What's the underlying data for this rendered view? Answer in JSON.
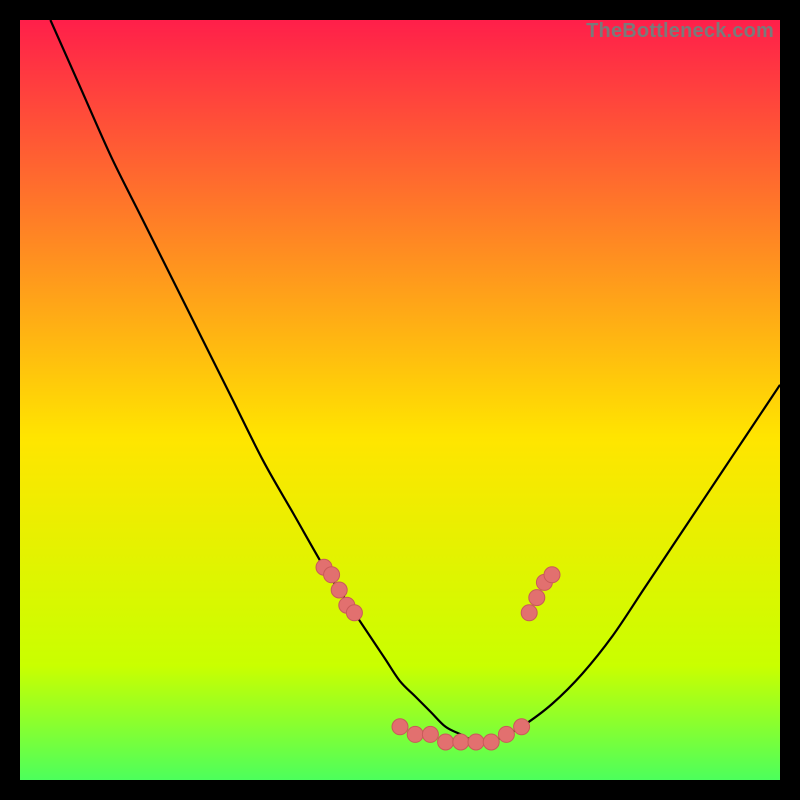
{
  "watermark": "TheBottleneck.com",
  "colors": {
    "bg_top": "#ff1f4a",
    "bg_mid": "#ffe500",
    "bg_low1": "#c9ff00",
    "bg_low2": "#4cff5c",
    "curve": "#000000",
    "dot_fill": "#e2706f",
    "dot_stroke": "#c95a59"
  },
  "chart_data": {
    "type": "line",
    "title": "",
    "xlabel": "",
    "ylabel": "",
    "xlim": [
      0,
      100
    ],
    "ylim": [
      0,
      100
    ],
    "series": [
      {
        "name": "bottleneck-curve",
        "type": "line",
        "x": [
          4,
          8,
          12,
          16,
          20,
          24,
          28,
          32,
          36,
          40,
          42,
          44,
          46,
          48,
          50,
          52,
          54,
          56,
          58,
          60,
          62,
          64,
          66,
          70,
          74,
          78,
          82,
          86,
          90,
          94,
          98,
          100
        ],
        "y": [
          100,
          91,
          82,
          74,
          66,
          58,
          50,
          42,
          35,
          28,
          25,
          22,
          19,
          16,
          13,
          11,
          9,
          7,
          6,
          5,
          5,
          6,
          7,
          10,
          14,
          19,
          25,
          31,
          37,
          43,
          49,
          52
        ]
      },
      {
        "name": "highlight-dots",
        "type": "scatter",
        "x": [
          40,
          41,
          42,
          43,
          44,
          50,
          52,
          54,
          56,
          58,
          60,
          62,
          64,
          66,
          67,
          68,
          69,
          70
        ],
        "y": [
          28,
          27,
          25,
          23,
          22,
          7,
          6,
          6,
          5,
          5,
          5,
          5,
          6,
          7,
          22,
          24,
          26,
          27
        ]
      }
    ],
    "annotations": []
  }
}
